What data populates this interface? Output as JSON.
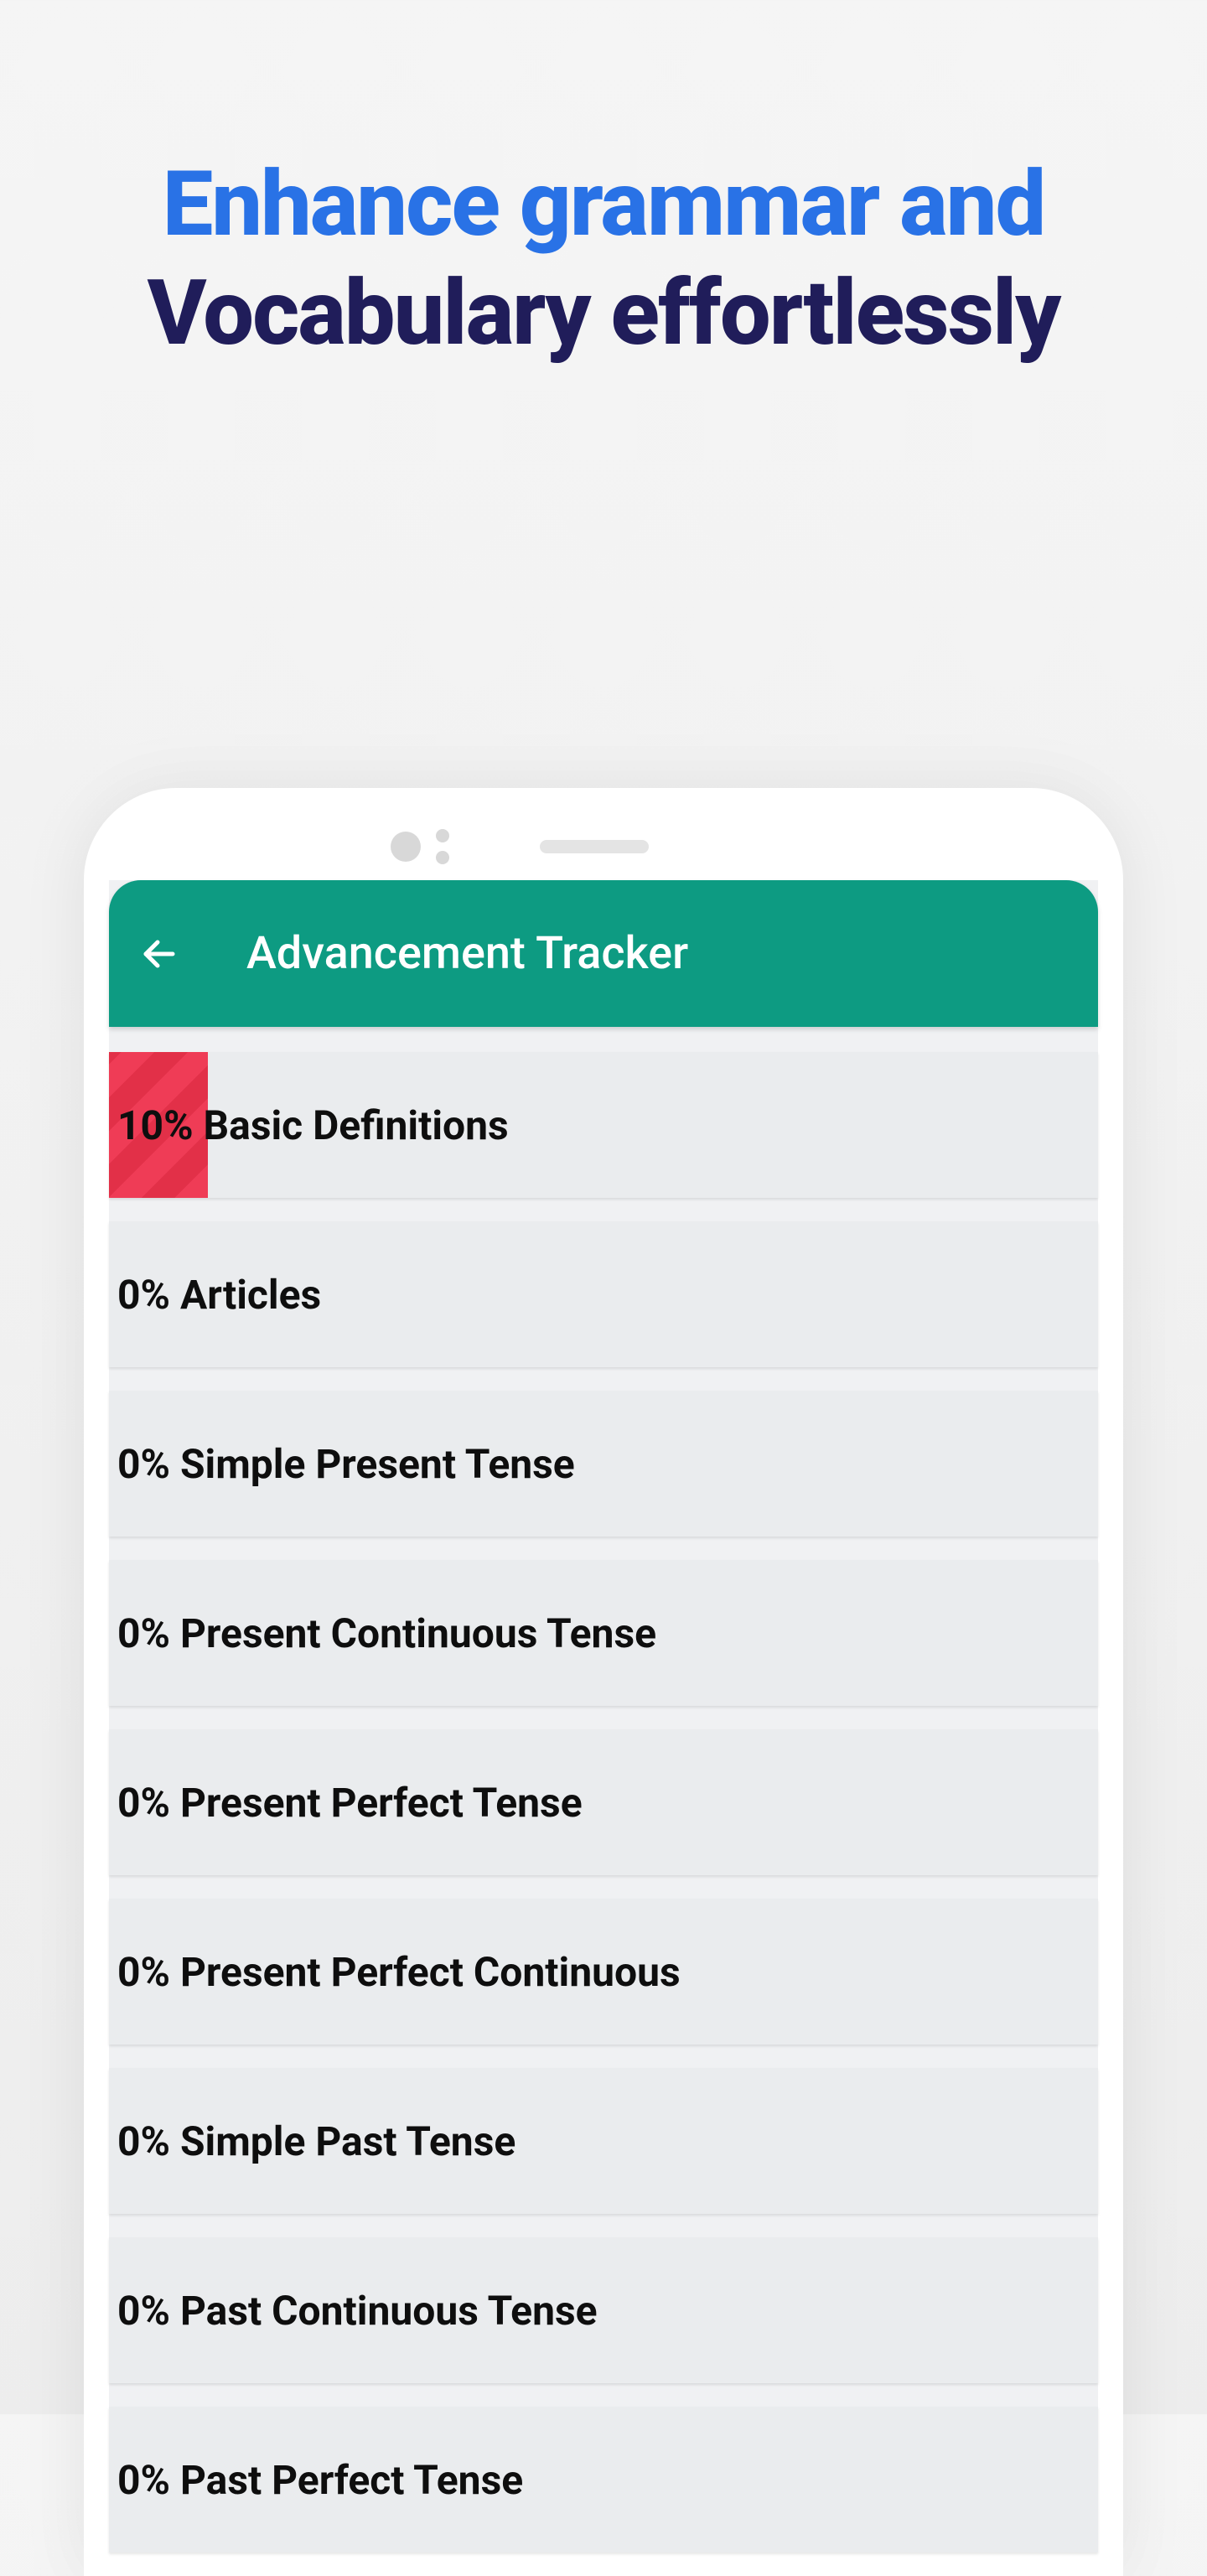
{
  "headline": {
    "line1": "Enhance grammar and",
    "line2": "Vocabulary effortlessly"
  },
  "app": {
    "title": "Advancement Tracker"
  },
  "items": [
    {
      "percent": 10,
      "label": "Basic Definitions"
    },
    {
      "percent": 0,
      "label": "Articles"
    },
    {
      "percent": 0,
      "label": "Simple Present Tense"
    },
    {
      "percent": 0,
      "label": "Present Continuous Tense"
    },
    {
      "percent": 0,
      "label": "Present Perfect Tense"
    },
    {
      "percent": 0,
      "label": "Present Perfect Continuous"
    },
    {
      "percent": 0,
      "label": "Simple Past Tense"
    },
    {
      "percent": 0,
      "label": "Past Continuous Tense"
    },
    {
      "percent": 0,
      "label": "Past Perfect Tense"
    }
  ]
}
